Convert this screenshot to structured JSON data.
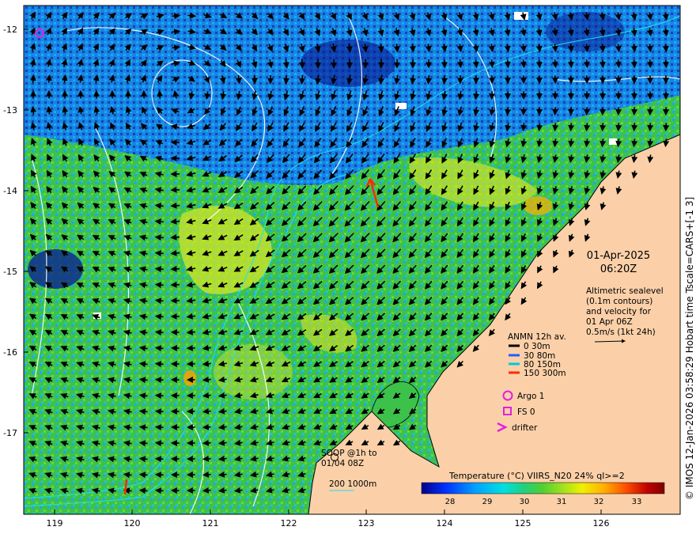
{
  "map": {
    "date": "01-Apr-2025",
    "time": "06:20Z",
    "lon_ticks": [
      "119",
      "120",
      "121",
      "122",
      "123",
      "124",
      "125",
      "126"
    ],
    "lat_ticks": [
      "-12",
      "-13",
      "-14",
      "-15",
      "-16",
      "-17"
    ],
    "description_lines": [
      "Altimetric sealevel",
      "(0.1m contours)",
      "and velocity for",
      "01 Apr 06Z",
      "0.5m/s (1kt 24h)"
    ],
    "credit": "© IMOS 12-Jan-2026 03:58:29 Hobart time Tscale=CARS+[-1 3]"
  },
  "legend": {
    "anmn_title": "ANMN 12h av.",
    "anmn_items": [
      {
        "label": "0 30m",
        "color": "#000000"
      },
      {
        "label": "30 80m",
        "color": "#1f5fff"
      },
      {
        "label": "80 150m",
        "color": "#00c8d8"
      },
      {
        "label": "150 300m",
        "color": "#ff2a00"
      }
    ],
    "argo": "Argo 1",
    "fs": "FS 0",
    "drifter": "drifter",
    "soop_line1": "SOOP @1h to",
    "soop_line2": "01/04 08Z",
    "bathy": "200  1000m",
    "marker_color": "#e020e0"
  },
  "colorbar": {
    "title": "Temperature (°C) VIIRS_N20 24% ql>=2",
    "ticks": [
      "28",
      "29",
      "30",
      "31",
      "32",
      "33"
    ],
    "colors": [
      "#00008a",
      "#0032ff",
      "#00a0ff",
      "#00e0e0",
      "#20d080",
      "#50d030",
      "#a0e020",
      "#f0f000",
      "#ffb000",
      "#ff5000",
      "#c00000",
      "#800000"
    ]
  }
}
